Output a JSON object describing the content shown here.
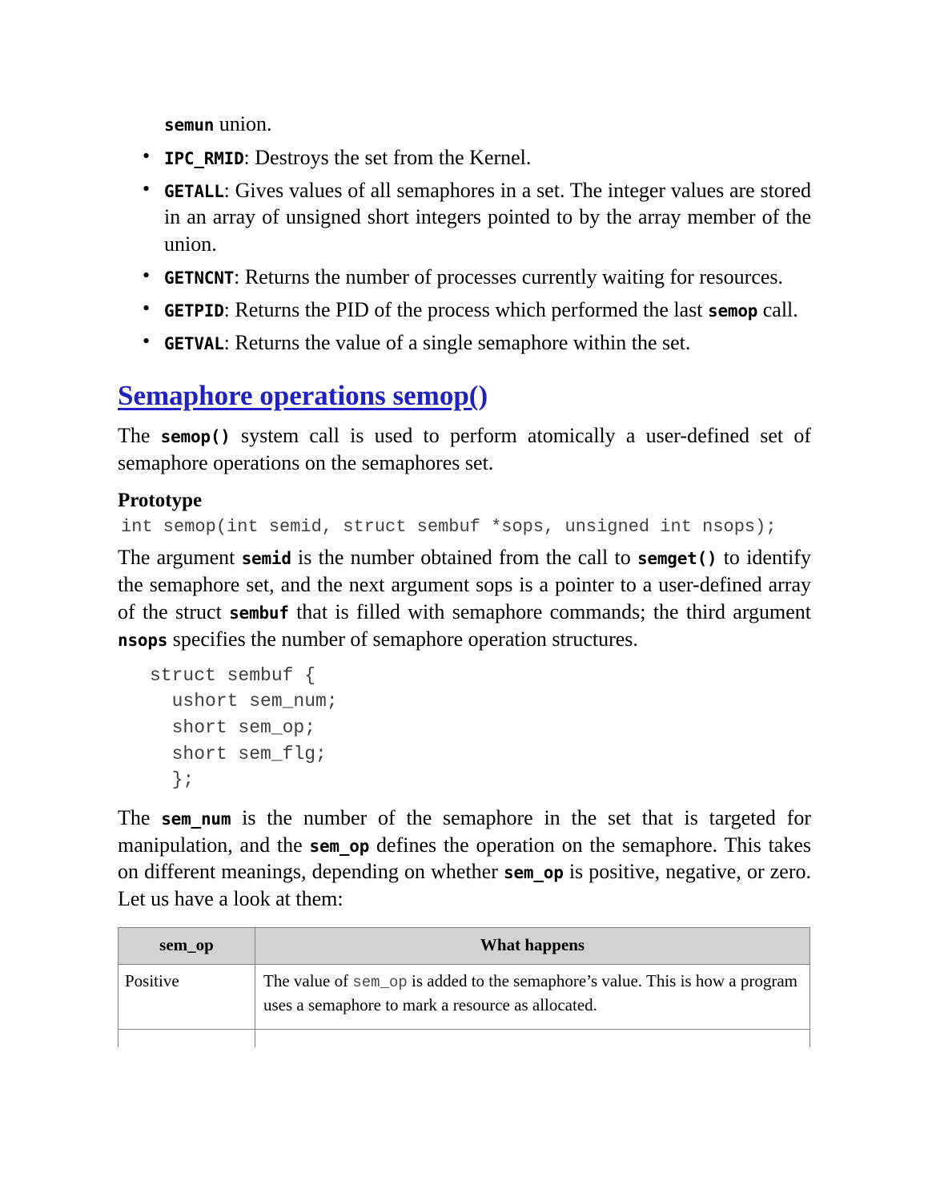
{
  "document": {
    "continuation_line": {
      "code": "semun",
      "text": " union."
    },
    "bullets": [
      {
        "code": "IPC_RMID",
        "text": ": Destroys the set from the Kernel."
      },
      {
        "code": "GETALL",
        "text": ": Gives values of all semaphores in a set. The integer values are stored in an array of unsigned short integers pointed to by the array member of the union."
      },
      {
        "code": "GETNCNT",
        "text": ": Returns the number of processes currently waiting for resources."
      },
      {
        "code": "GETPID",
        "text": ": Returns the PID of the process which performed the last ",
        "code2": "semop",
        "text2": " call."
      },
      {
        "code": "GETVAL",
        "text": ": Returns the value of a single semaphore within the set."
      }
    ],
    "heading": {
      "underlined": "Semaphore operations semop(",
      "tail": ")"
    },
    "intro_paragraph": {
      "part1": "The ",
      "code1": "semop()",
      "part2": " system call is used to perform atomically a user-defined set of semaphore operations on the semaphores set."
    },
    "prototype_heading": "Prototype",
    "prototype_code": "int semop(int semid, struct sembuf *sops, unsigned int nsops);",
    "argument_paragraph": {
      "part1": "The argument ",
      "code1": "semid",
      "part2": " is the number obtained from the call to ",
      "code2": "semget()",
      "part3": " to identify the semaphore set, and the next argument sops is a pointer to a user-defined array of the struct ",
      "code3": "sembuf",
      "part4": " that is filled with semaphore commands; the third argument ",
      "code4": "nsops",
      "part5": " specifies the number of semaphore operation structures."
    },
    "struct_code": "struct sembuf {\n  ushort sem_num;\n  short sem_op;\n  short sem_flg;\n  };",
    "sem_num_paragraph": {
      "part1": "The ",
      "code1": "sem_num",
      "part2": " is the number of the semaphore in the set that is targeted for manipulation, and the ",
      "code2": "sem_op",
      "part3": " defines the operation on the semaphore. This takes on different meanings, depending on whether ",
      "code3": "sem_op",
      "part4": " is positive, negative, or zero. Let us have a look at them:"
    },
    "table": {
      "headers": [
        "sem_op",
        "What happens"
      ],
      "rows": [
        {
          "label": "Positive",
          "desc_part1": "The value of ",
          "desc_code": "sem_op",
          "desc_part2": " is added to the semaphore’s value. This is how a program uses a semaphore to mark a resource as allocated."
        }
      ]
    }
  },
  "colors": {
    "heading_blue": "#2020c8",
    "table_header_bg": "#d2d2d2",
    "table_border": "#808080",
    "code_gray": "#3f3f3f",
    "page_bg": "#ffffff"
  }
}
